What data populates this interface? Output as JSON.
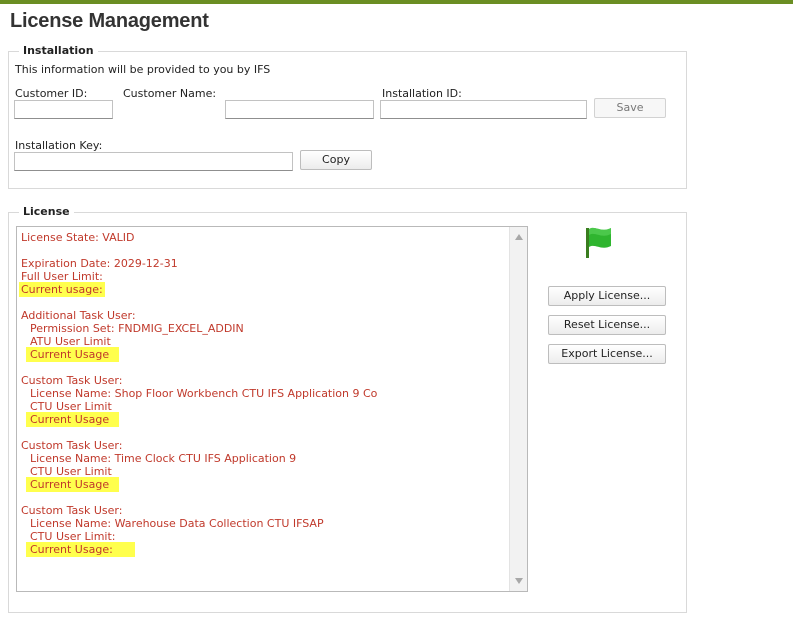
{
  "page": {
    "title": "License Management"
  },
  "installation": {
    "group_title": "Installation",
    "info_text": "This information will be provided to you by IFS",
    "customer_id_label": "Customer ID:",
    "customer_name_label": "Customer Name:",
    "installation_id_label": "Installation ID:",
    "installation_key_label": "Installation Key:",
    "customer_id_value": "",
    "customer_name_value": "",
    "installation_id_value": "",
    "installation_key_value": "",
    "save_label": "Save",
    "copy_label": "Copy"
  },
  "license": {
    "group_title": "License",
    "lines": [
      "License State: VALID",
      "Expiration Date: 2029-12-31",
      "Full User Limit:",
      "Current usage:",
      "Additional Task User:",
      "Permission Set: FNDMIG_EXCEL_ADDIN",
      "ATU User Limit",
      "Current Usage",
      "Custom Task User:",
      "License Name: Shop Floor Workbench CTU IFS Application 9 Co",
      "CTU User Limit",
      "Current Usage",
      "Custom Task User:",
      "License Name: Time Clock CTU IFS Application 9",
      "CTU User Limit",
      "Current Usage",
      "Custom Task User:",
      "License Name: Warehouse Data Collection CTU IFSAP",
      "CTU User Limit:",
      "Current Usage:"
    ],
    "apply_label": "Apply License...",
    "reset_label": "Reset License...",
    "export_label": "Export License..."
  },
  "colors": {
    "accent": "#6b8e23",
    "license_text": "#c0392b",
    "highlight": "#ffff4d",
    "flag": "#2fb52f"
  },
  "icons": {
    "status_flag": "flag-icon"
  }
}
